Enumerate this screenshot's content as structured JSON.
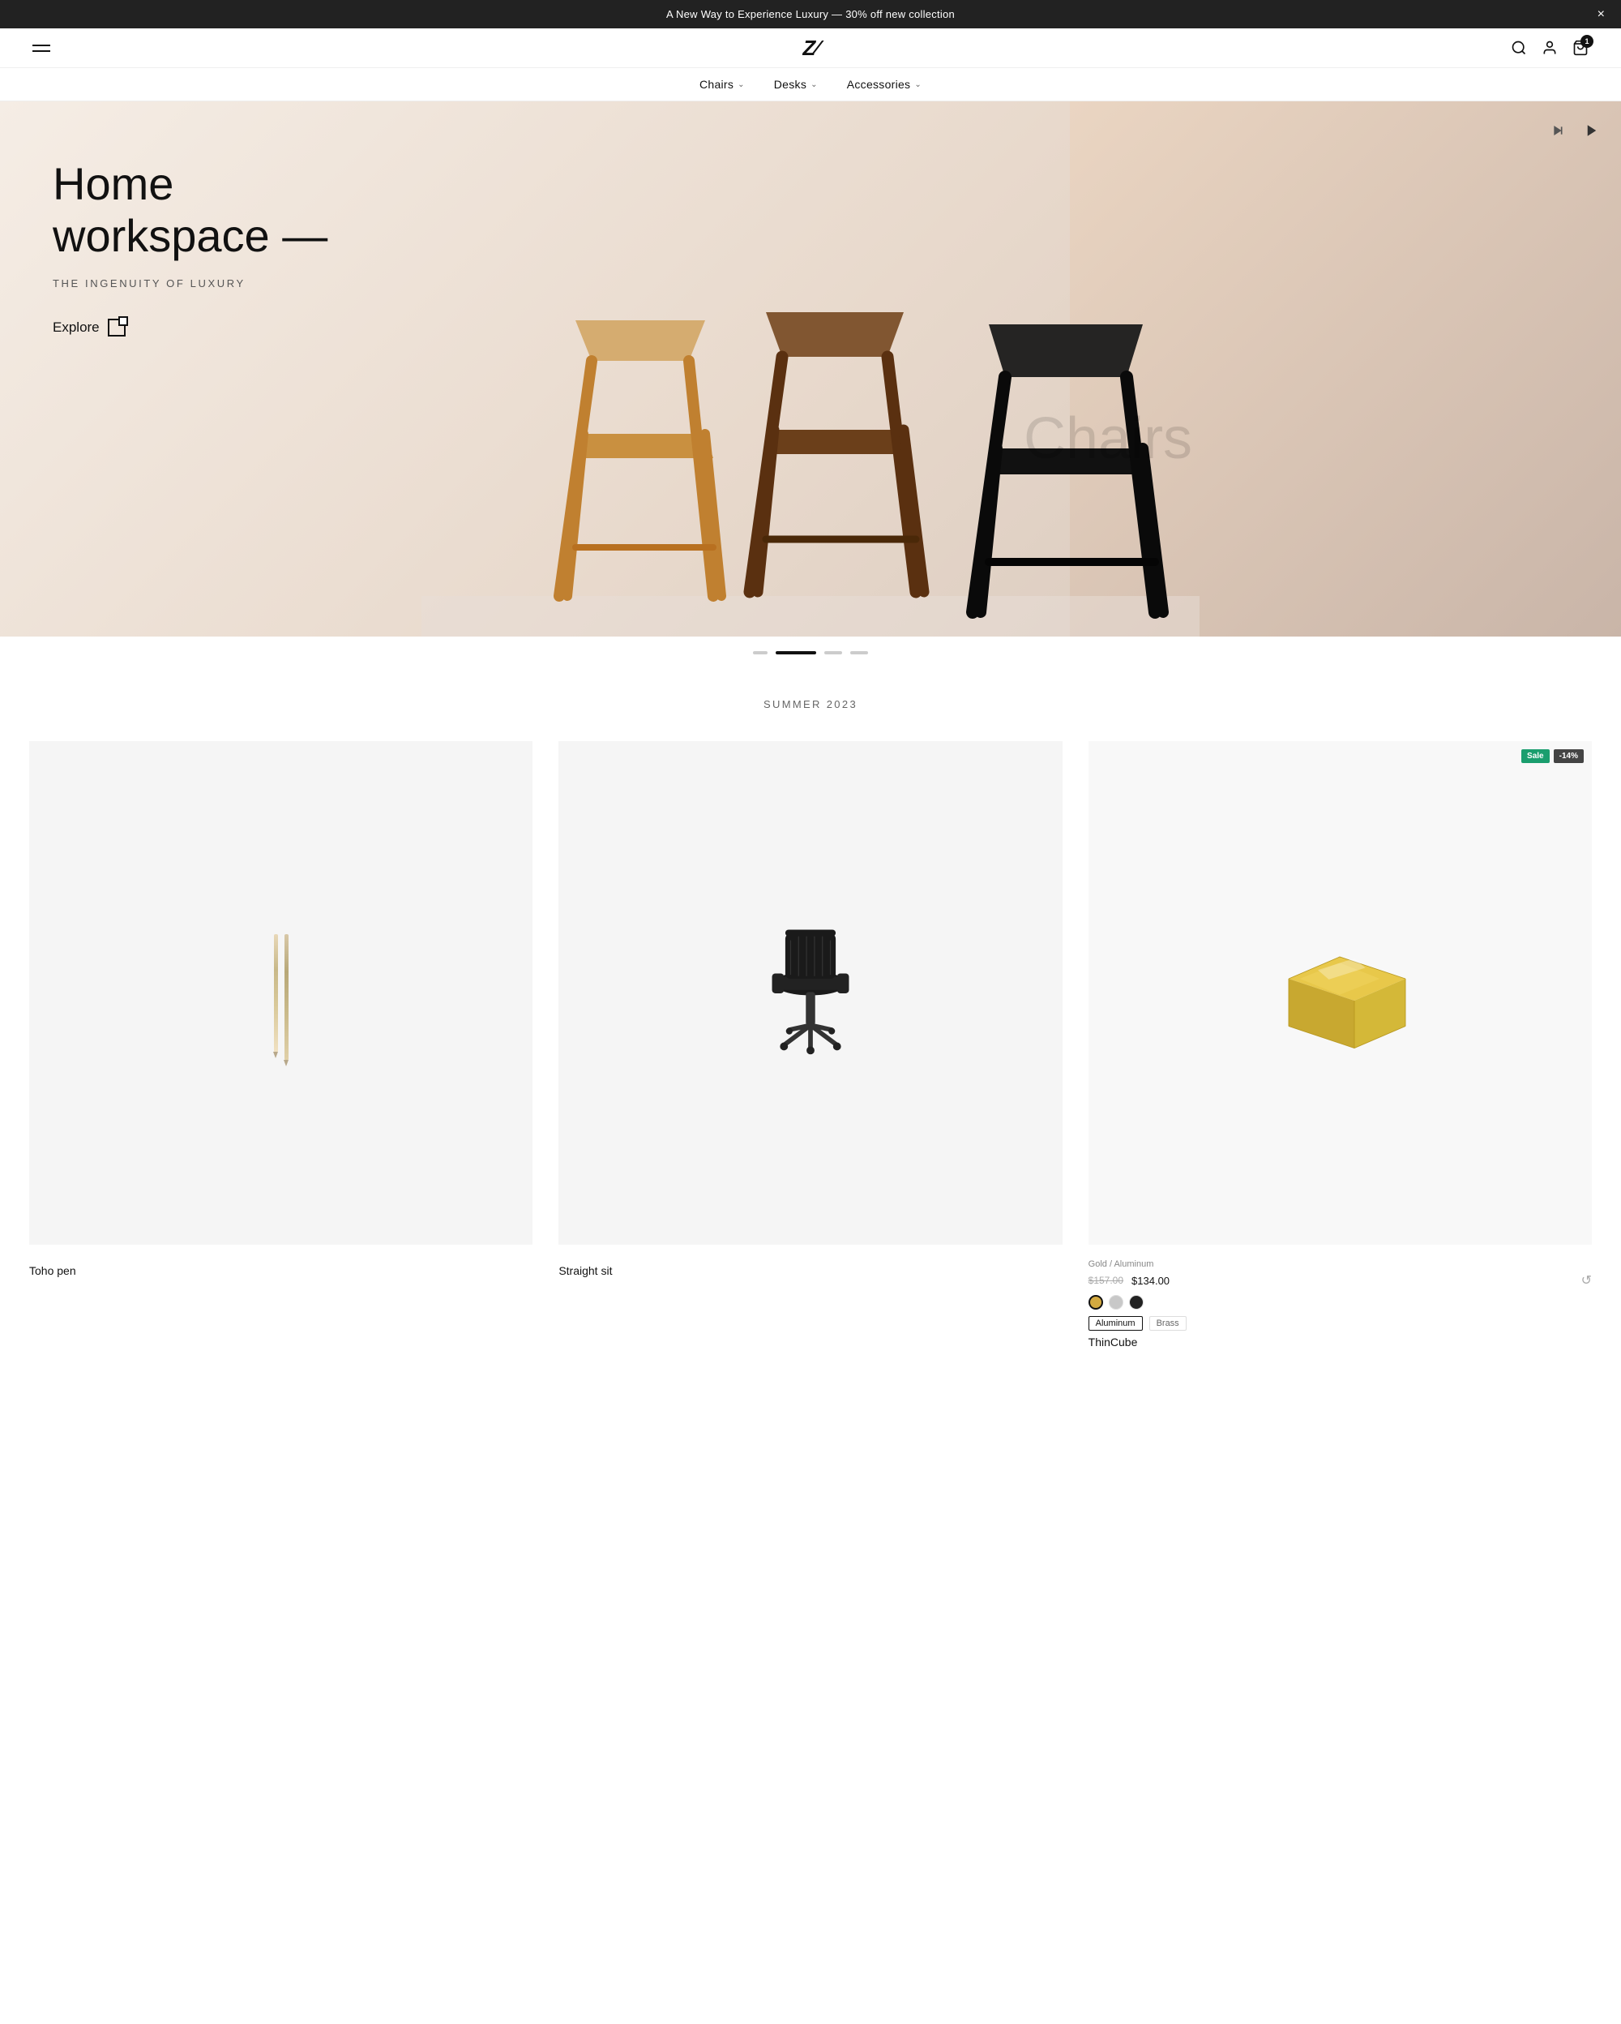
{
  "announcement": {
    "text": "A New Way to Experience Luxury — 30% off new collection",
    "close_label": "×"
  },
  "header": {
    "logo": "Z/",
    "cart_count": "1"
  },
  "nav": {
    "items": [
      {
        "label": "Chairs",
        "has_dropdown": true
      },
      {
        "label": "Desks",
        "has_dropdown": true
      },
      {
        "label": "Accessories",
        "has_dropdown": true
      }
    ]
  },
  "hero": {
    "title": "Home\nworkspace —",
    "subtitle": "THE INGENUITY OF LUXURY",
    "explore_label": "Explore",
    "slide_indicator": "2 of 4"
  },
  "summer_label": "SUMMER 2023",
  "products": [
    {
      "id": "toho-pen",
      "name": "Toho pen",
      "material": null,
      "price_original": null,
      "price_sale": null,
      "has_sale": false,
      "discount": null,
      "colors": [],
      "material_options": [],
      "type": "pen"
    },
    {
      "id": "straight-sit",
      "name": "Straight sit",
      "material": null,
      "price_original": null,
      "price_sale": null,
      "has_sale": false,
      "discount": null,
      "colors": [],
      "material_options": [],
      "type": "office-chair"
    },
    {
      "id": "thincube",
      "name": "ThinCube",
      "material": "Gold / Aluminum",
      "price_original": "$157.00",
      "price_sale": "$134.00",
      "has_sale": true,
      "discount": "-14%",
      "sale_label": "Sale",
      "colors": [
        {
          "name": "gold",
          "hex": "#D4AA40",
          "selected": true
        },
        {
          "name": "silver",
          "hex": "#C8C8C8",
          "selected": false
        },
        {
          "name": "black",
          "hex": "#222222",
          "selected": false
        }
      ],
      "material_options": [
        {
          "label": "Aluminum",
          "selected": true
        },
        {
          "label": "Brass",
          "selected": false
        }
      ],
      "type": "cube"
    }
  ],
  "icons": {
    "search": "🔍",
    "user": "👤",
    "cart": "🛒",
    "wishlist": "↻",
    "play": "▶",
    "stop": "■"
  }
}
